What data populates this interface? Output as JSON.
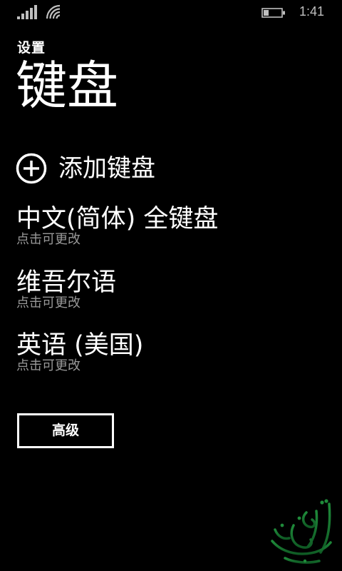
{
  "status_bar": {
    "time": "1:41",
    "icons": [
      "signal-strength-icon",
      "wifi-icon",
      "battery-icon"
    ],
    "signal_bars": 5,
    "battery_level": 0.25
  },
  "header": {
    "app_title": "设置",
    "page_title": "键盘"
  },
  "add_keyboard": {
    "icon": "plus-circle-icon",
    "label": "添加键盘"
  },
  "keyboards": [
    {
      "name": "中文(简体) 全键盘",
      "subtitle": "点击可更改"
    },
    {
      "name": "维吾尔语",
      "subtitle": "点击可更改"
    },
    {
      "name": "英语 (美国)",
      "subtitle": "点击可更改"
    }
  ],
  "advanced_button": {
    "label": "高级"
  },
  "colors": {
    "background": "#000000",
    "text": "#ffffff",
    "subtext": "#999999",
    "status": "#bfbfbf"
  }
}
